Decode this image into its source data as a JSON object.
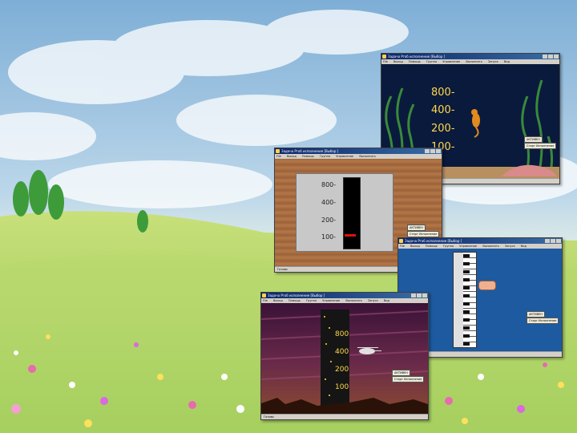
{
  "windows": {
    "aquarium": {
      "title": "Задача Ргоб исполнение [Выбор   ]",
      "menu": [
        "File",
        "Выход",
        "Помощь",
        "Группа",
        "Управление",
        "Выполнить",
        "Запуск",
        "Вид"
      ],
      "scale": [
        "800-",
        "400-",
        "200-",
        "100-"
      ],
      "buttons": [
        "АКТИВЕН",
        "Старт Исполнение"
      ],
      "status": "Готово"
    },
    "thermometer": {
      "title": "Задача Ргоб исполнение [Выбор   ]",
      "menu": [
        "File",
        "Выход",
        "Помощь",
        "Группа",
        "Управление",
        "Выполнить"
      ],
      "scale": [
        "800-",
        "400-",
        "200-",
        "100-"
      ],
      "buttons": [
        "АКТИВЕН",
        "Старт Исполнение"
      ],
      "status": "Готово"
    },
    "piano": {
      "title": "Задача Ргоб исполнение [Выбор   ]",
      "menu": [
        "File",
        "Выход",
        "Помощь",
        "Группа",
        "Управление",
        "Выполнить",
        "Запуск",
        "Вид"
      ],
      "buttons": [
        "АКТИВЕН",
        "Старт Исполнение"
      ],
      "status": ""
    },
    "tower": {
      "title": "Задача Ргоб исполнение [Выбор   ]",
      "menu": [
        "File",
        "Выход",
        "Помощь",
        "Группа",
        "Управление",
        "Выполнить",
        "Запуск",
        "Вид"
      ],
      "scale": [
        "800",
        "400",
        "200",
        "100"
      ],
      "buttons": [
        "АКТИВЕН",
        "Старт Исполнение"
      ],
      "status": "Готово"
    }
  },
  "colors": {
    "sky_top": "#8fb9dc",
    "grass": "#a8d45a",
    "aquarium_bg": "#0a1a3c",
    "scale_text": "#ffd84a",
    "piano_bg": "#1d5aa0",
    "tower_sky": "#4a1a40"
  }
}
